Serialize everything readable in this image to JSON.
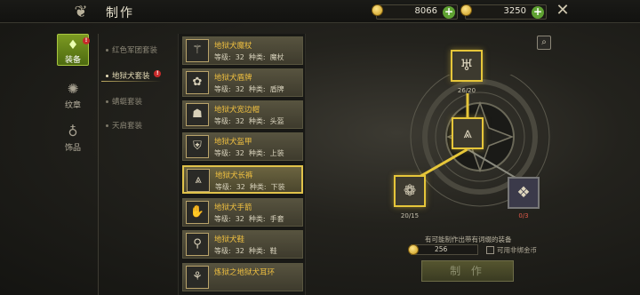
{
  "header": {
    "title": "制作",
    "logo_icon": "dragon-emblem-icon",
    "currencies": [
      {
        "name": "gold",
        "icon": "gold-coin-icon",
        "value": "8066"
      },
      {
        "name": "gold",
        "icon": "gold-coin-icon",
        "value": "3250"
      }
    ],
    "close_icon": "close-icon"
  },
  "categories": [
    {
      "label": "装备",
      "icon": "equipment-icon",
      "active": true,
      "badge": "!"
    },
    {
      "label": "纹章",
      "icon": "emblem-icon",
      "active": false
    },
    {
      "label": "饰品",
      "icon": "accessory-icon",
      "active": false
    }
  ],
  "subcategories": [
    {
      "label": "红色军团套装",
      "active": false
    },
    {
      "label": "地狱犬套装",
      "active": true,
      "badge": "!"
    },
    {
      "label": "蜻蜓套装",
      "active": false
    },
    {
      "label": "天启套装",
      "active": false
    }
  ],
  "item_labels": {
    "level": "等级:",
    "type": "种类:"
  },
  "items": [
    {
      "name": "地狱犬魔杖",
      "level": "32",
      "type": "魔杖",
      "icon": "wand-icon",
      "selected": false
    },
    {
      "name": "地狱犬盾牌",
      "level": "32",
      "type": "盾牌",
      "icon": "shield-icon",
      "selected": false
    },
    {
      "name": "地狱犬宽边帽",
      "level": "32",
      "type": "头盔",
      "icon": "helmet-icon",
      "selected": false
    },
    {
      "name": "地狱犬盔甲",
      "level": "32",
      "type": "上装",
      "icon": "armor-icon",
      "selected": false
    },
    {
      "name": "地狱犬长裤",
      "level": "32",
      "type": "下装",
      "icon": "pants-icon",
      "selected": true
    },
    {
      "name": "地狱犬手箭",
      "level": "32",
      "type": "手套",
      "icon": "gloves-icon",
      "selected": false
    },
    {
      "name": "地狱犬鞋",
      "level": "32",
      "type": "鞋",
      "icon": "boots-icon",
      "selected": false
    },
    {
      "name": "炼狱之地狱犬耳环",
      "level": "",
      "type": "",
      "icon": "earring-icon",
      "selected": false
    }
  ],
  "recipe": {
    "result": {
      "icon": "pants-icon"
    },
    "materials": [
      {
        "icon": "armor-piece-icon",
        "count": "26/20",
        "enough": true
      },
      {
        "icon": "treasure-chest-icon",
        "count": "20/15",
        "enough": true
      },
      {
        "icon": "paw-crystal-icon",
        "count": "0/3",
        "enough": false
      }
    ],
    "hint": "有可能制作出带有词缀的装备",
    "cost": "256",
    "use_bound_gold_label": "可用非绑金币",
    "craft_button": "制 作",
    "search_icon": "magnifier-icon"
  }
}
